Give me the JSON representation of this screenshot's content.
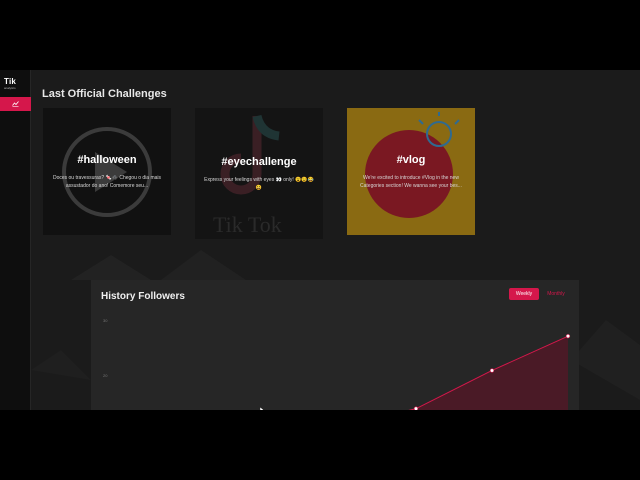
{
  "app": {
    "logo_line1": "Tik",
    "logo_line2": "analytics"
  },
  "section": {
    "title": "Last Official Challenges"
  },
  "challenges": [
    {
      "tag": "#halloween",
      "desc": "Doces ou travessuras? 🍬🕷️ Chegou o dia mais assustador do ano! Comemore seu...",
      "bg": "#111111"
    },
    {
      "tag": "#eyechallenge",
      "desc": "Express your feelings with eyes 👀 only! 😮😉😂😃",
      "bg": "#141414"
    },
    {
      "tag": "#vlog",
      "desc": "We're excited to introduce #Vlog in the new Categories section! We wanna see your bes...",
      "bg": "#8a6a12"
    }
  ],
  "followers": {
    "title": "History Followers",
    "weekly_label": "Weekly",
    "monthly_label": "Monthly",
    "ytick_labels": [
      "30",
      "20"
    ]
  },
  "colors": {
    "accent": "#d5174b",
    "background": "#1b1b1b",
    "panel": "#262626"
  },
  "icons": {
    "nav": "chart-icon",
    "breadcrumb": "chevron-right-icon"
  },
  "chart_data": {
    "type": "area",
    "x": [
      1,
      2,
      3,
      4
    ],
    "y": [
      15.4,
      18.3,
      24.2,
      29.5
    ],
    "ylim": [
      15,
      32
    ],
    "yticks": [
      20,
      30
    ],
    "grid": false
  }
}
